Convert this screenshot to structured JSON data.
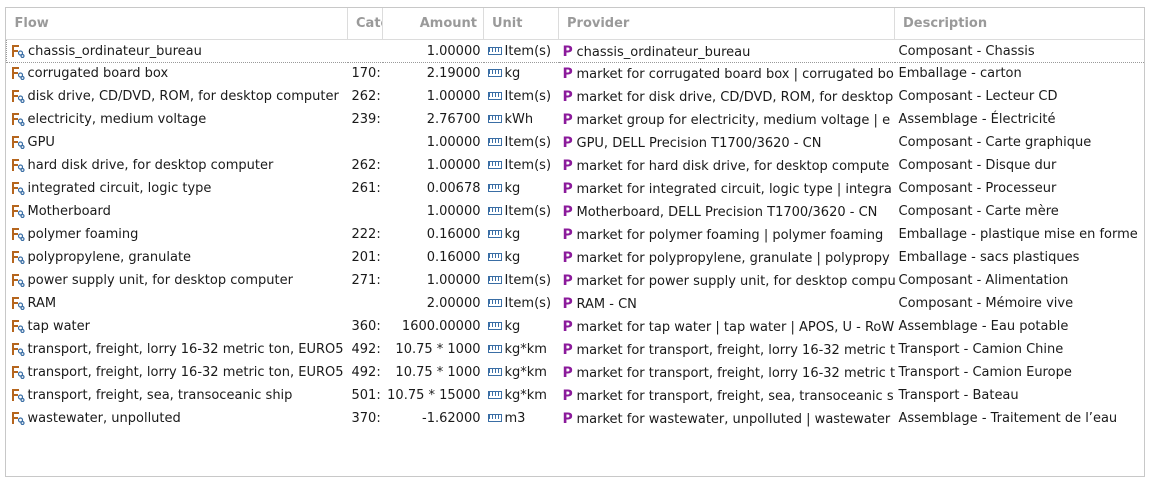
{
  "columns": {
    "flow": "Flow",
    "category": "Cate",
    "amount": "Amount",
    "unit": "Unit",
    "provider": "Provider",
    "description": "Description"
  },
  "icons": {
    "flow": "flow-icon",
    "unit": "unit-ruler-icon",
    "provider": "process-p-icon",
    "provider_glyph": "P"
  },
  "colors": {
    "provider_icon": "#8b1a9b",
    "header_text": "#9a9a9a"
  },
  "rows": [
    {
      "flow": "chassis_ordinateur_bureau",
      "category": "",
      "amount": "1.00000",
      "unit": "Item(s)",
      "provider": "chassis_ordinateur_bureau",
      "description": "Composant - Chassis"
    },
    {
      "flow": "corrugated board box",
      "category": "170:",
      "amount": "2.19000",
      "unit": "kg",
      "provider": "market for corrugated board box | corrugated bo",
      "description": "Emballage - carton"
    },
    {
      "flow": "disk drive, CD/DVD, ROM, for desktop computer",
      "category": "262:",
      "amount": "1.00000",
      "unit": "Item(s)",
      "provider": "market for disk drive, CD/DVD, ROM, for desktop",
      "description": "Composant - Lecteur CD"
    },
    {
      "flow": "electricity, medium voltage",
      "category": "239:",
      "amount": "2.76700",
      "unit": "kWh",
      "provider": "market group for electricity, medium voltage | e",
      "description": "Assemblage - Électricité"
    },
    {
      "flow": "GPU",
      "category": "",
      "amount": "1.00000",
      "unit": "Item(s)",
      "provider": "GPU, DELL Precision T1700/3620 - CN",
      "description": "Composant - Carte graphique"
    },
    {
      "flow": "hard disk drive, for desktop computer",
      "category": "262:",
      "amount": "1.00000",
      "unit": "Item(s)",
      "provider": "market for hard disk drive, for desktop compute",
      "description": "Composant - Disque dur"
    },
    {
      "flow": "integrated circuit, logic type",
      "category": "261:",
      "amount": "0.00678",
      "unit": "kg",
      "provider": "market for integrated circuit, logic type | integra",
      "description": "Composant - Processeur"
    },
    {
      "flow": "Motherboard",
      "category": "",
      "amount": "1.00000",
      "unit": "Item(s)",
      "provider": "Motherboard, DELL Precision T1700/3620 - CN",
      "description": "Composant - Carte mère"
    },
    {
      "flow": "polymer foaming",
      "category": "222:",
      "amount": "0.16000",
      "unit": "kg",
      "provider": "market for polymer foaming | polymer foaming",
      "description": "Emballage - plastique mise en forme"
    },
    {
      "flow": "polypropylene, granulate",
      "category": "201:",
      "amount": "0.16000",
      "unit": "kg",
      "provider": "market for polypropylene, granulate | polypropy",
      "description": "Emballage - sacs plastiques"
    },
    {
      "flow": "power supply unit, for desktop computer",
      "category": "271:",
      "amount": "1.00000",
      "unit": "Item(s)",
      "provider": "market for power supply unit, for desktop compu",
      "description": "Composant - Alimentation"
    },
    {
      "flow": "RAM",
      "category": "",
      "amount": "2.00000",
      "unit": "Item(s)",
      "provider": "RAM - CN",
      "description": "Composant - Mémoire vive"
    },
    {
      "flow": "tap water",
      "category": "360:",
      "amount": "1600.00000",
      "unit": "kg",
      "provider": "market for tap water | tap water | APOS, U - RoW",
      "description": "Assemblage - Eau potable"
    },
    {
      "flow": "transport, freight, lorry 16-32 metric ton, EURO5",
      "category": "492:",
      "amount": "10.75 * 1000",
      "unit": "kg*km",
      "provider": "market for transport, freight, lorry 16-32 metric t",
      "description": "Transport -  Camion Chine"
    },
    {
      "flow": "transport, freight, lorry 16-32 metric ton, EURO5",
      "category": "492:",
      "amount": "10.75 * 1000",
      "unit": "kg*km",
      "provider": "market for transport, freight, lorry 16-32 metric t",
      "description": "Transport - Camion Europe"
    },
    {
      "flow": "transport, freight, sea, transoceanic ship",
      "category": "501:",
      "amount": "10.75 * 15000",
      "unit": "kg*km",
      "provider": "market for transport, freight, sea, transoceanic s",
      "description": "Transport - Bateau"
    },
    {
      "flow": "wastewater, unpolluted",
      "category": "370:",
      "amount": "-1.62000",
      "unit": "m3",
      "provider": "market for wastewater, unpolluted | wastewater",
      "description": "Assemblage - Traitement de l’eau"
    }
  ]
}
